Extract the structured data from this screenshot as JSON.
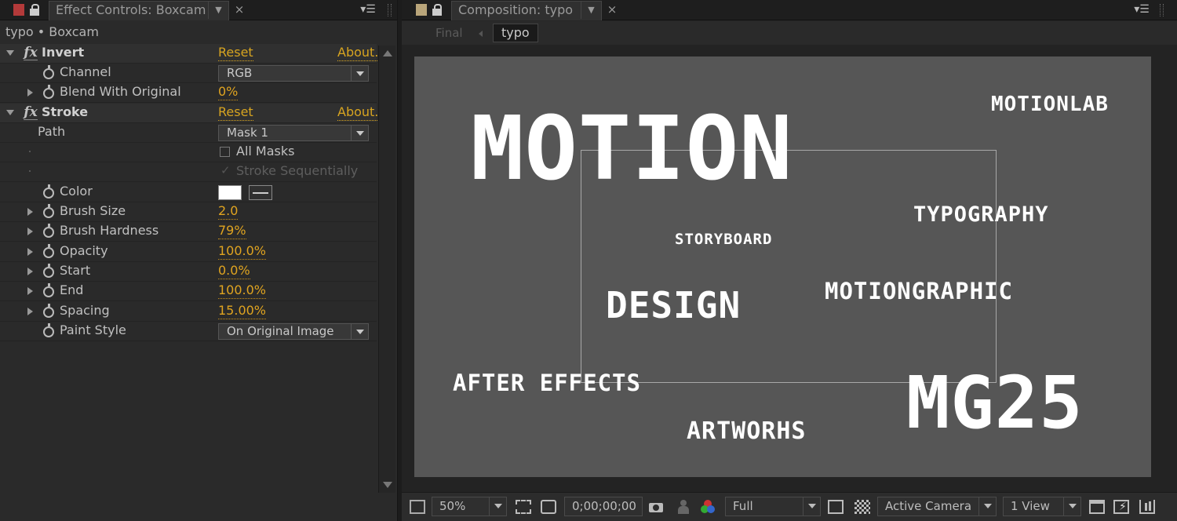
{
  "effect_controls": {
    "tab_title": "Effect Controls: Boxcam",
    "breadcrumb": "typo • Boxcam",
    "effects": {
      "invert": {
        "name": "Invert",
        "reset_label": "Reset",
        "about_label": "About...",
        "channel_label": "Channel",
        "channel_value": "RGB",
        "blend_label": "Blend With Original",
        "blend_value": "0%"
      },
      "stroke": {
        "name": "Stroke",
        "reset_label": "Reset",
        "about_label": "About...",
        "path_label": "Path",
        "path_value": "Mask 1",
        "all_masks_label": "All Masks",
        "stroke_sequentially_label": "Stroke Sequentially",
        "color_label": "Color",
        "color_value": "#ffffff",
        "brush_size_label": "Brush Size",
        "brush_size_value": "2.0",
        "brush_hardness_label": "Brush Hardness",
        "brush_hardness_value": "79%",
        "opacity_label": "Opacity",
        "opacity_value": "100.0%",
        "start_label": "Start",
        "start_value": "0.0%",
        "end_label": "End",
        "end_value": "100.0%",
        "spacing_label": "Spacing",
        "spacing_value": "15.00%",
        "paint_style_label": "Paint Style",
        "paint_style_value": "On Original Image"
      }
    }
  },
  "composition": {
    "tab_title": "Composition: typo",
    "flow_final": "Final",
    "flow_current": "typo",
    "words": {
      "motion": "MOTION",
      "motionlab": "MOTIONLAB",
      "typography": "TYPOGRAPHY",
      "storyboard": "STORYBOARD",
      "design": "DESIGN",
      "motiongraphic": "MOTIONGRAPHIC",
      "after_effects": "AFTER EFFECTS",
      "artworks": "ARTWORHS",
      "mg25": "MG25"
    },
    "toolbar": {
      "zoom": "50%",
      "timecode": "0;00;00;00",
      "resolution": "Full",
      "camera": "Active Camera",
      "view_layout": "1 View"
    }
  },
  "colors": {
    "accent_value": "#e0a420",
    "comp_background": "#565656"
  }
}
